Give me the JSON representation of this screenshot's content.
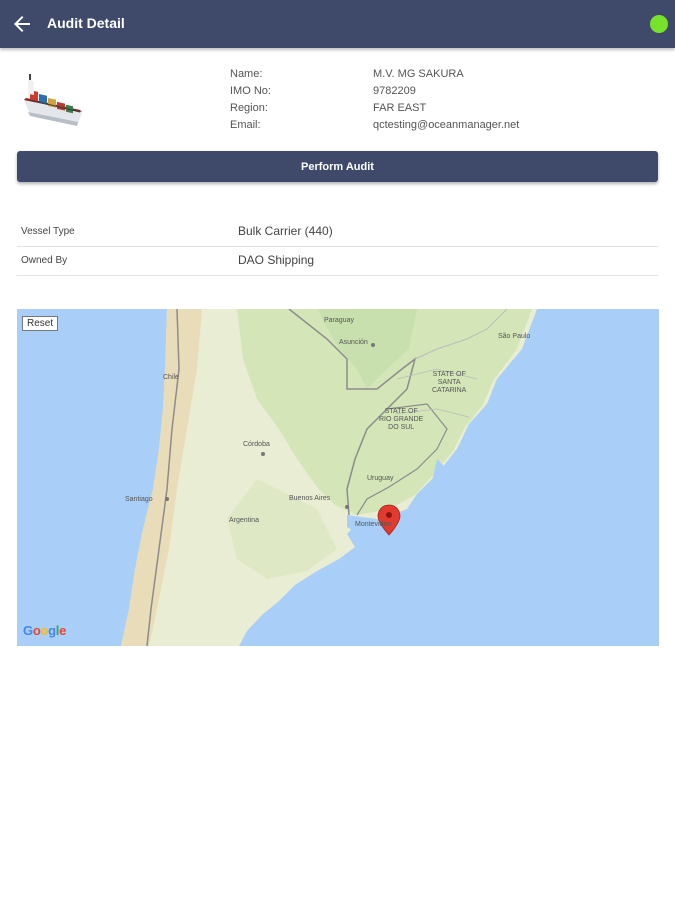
{
  "appbar": {
    "title": "Audit Detail",
    "back_icon": "arrow-left-icon",
    "status_color": "#76e22a",
    "bar_color": "#3f4a6b"
  },
  "vessel_info": {
    "rows": [
      {
        "label": "Name:",
        "value": "M.V. MG SAKURA"
      },
      {
        "label": "IMO No:",
        "value": "9782209"
      },
      {
        "label": "Region:",
        "value": "FAR EAST"
      },
      {
        "label": "Email:",
        "value": "qctesting@oceanmanager.net"
      }
    ]
  },
  "perform_button": {
    "label": "Perform Audit"
  },
  "details": {
    "rows": [
      {
        "label": "Vessel Type",
        "value": "Bulk Carrier (440)"
      },
      {
        "label": "Owned By",
        "value": "DAO Shipping"
      }
    ]
  },
  "map": {
    "reset_label": "Reset",
    "google_letters": [
      "G",
      "o",
      "o",
      "g",
      "l",
      "e"
    ],
    "labels": {
      "paraguay": "Paraguay",
      "asuncion": "Asunción",
      "sao_paulo": "São Paulo",
      "chile": "Chile",
      "santa_catarina": "STATE OF\nSANTA\nCATARINA",
      "rio_grande": "STATE OF\nRIO GRANDE\nDO SUL",
      "cordoba": "Córdoba",
      "uruguay": "Uruguay",
      "santiago": "Santiago",
      "buenos_aires": "Buenos Aires",
      "argentina": "Argentina",
      "montevideo": "Montevideo"
    }
  }
}
